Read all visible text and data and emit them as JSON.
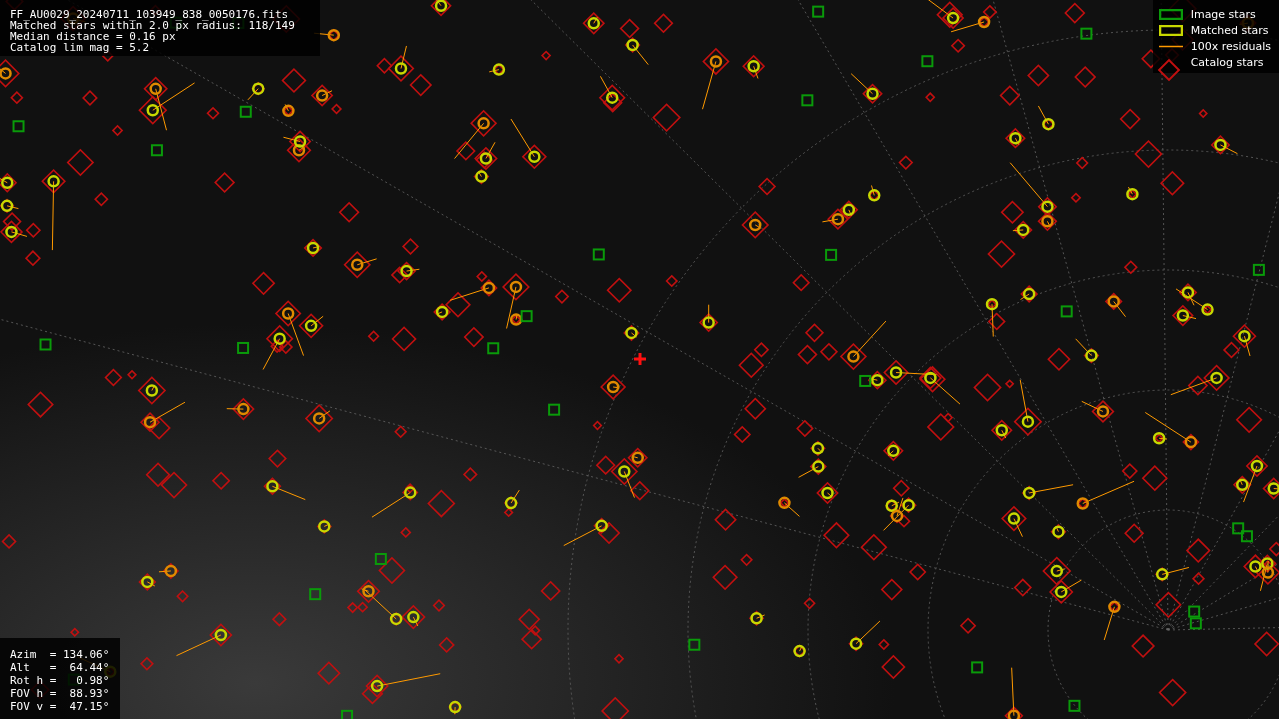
{
  "info": [
    "FF_AU0029_20240711_103949_838_0050176.fits",
    "Matched stars within 2.0 px radius: 118/149",
    "Median distance = 0.16 px",
    "Catalog lim mag = 5.2"
  ],
  "legend": [
    {
      "kind": "image",
      "label": "Image stars"
    },
    {
      "kind": "matched",
      "label": "Matched stars"
    },
    {
      "kind": "residual",
      "label": "100x residuals"
    },
    {
      "kind": "catalog",
      "label": "Catalog stars"
    }
  ],
  "pointing": [
    "Azim  = 134.06°",
    "Alt   =  64.44°",
    "Rot h =   0.98°",
    "FOV h =  88.93°",
    "FOV v =  47.15°"
  ]
}
